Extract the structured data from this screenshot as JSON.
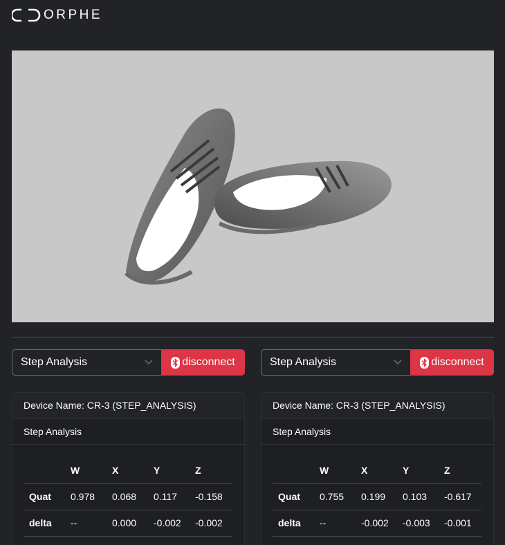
{
  "app": {
    "brand": "ORPHE"
  },
  "viewer": {
    "description": ""
  },
  "panels": [
    {
      "mode_select": "Step Analysis",
      "disconnect_label": "disconnect",
      "device_name": "Device Name: CR-3 (STEP_ANALYSIS)",
      "section_title": "Step Analysis",
      "table": {
        "headers": [
          "",
          "W",
          "X",
          "Y",
          "Z"
        ],
        "rows": [
          [
            "Quat",
            "0.978",
            "0.068",
            "0.117",
            "-0.158"
          ],
          [
            "delta",
            "--",
            "0.000",
            "-0.002",
            "-0.002"
          ]
        ]
      }
    },
    {
      "mode_select": "Step Analysis",
      "disconnect_label": "disconnect",
      "device_name": "Device Name: CR-3 (STEP_ANALYSIS)",
      "section_title": "Step Analysis",
      "table": {
        "headers": [
          "",
          "W",
          "X",
          "Y",
          "Z"
        ],
        "rows": [
          [
            "Quat",
            "0.755",
            "0.199",
            "0.103",
            "-0.617"
          ],
          [
            "delta",
            "--",
            "-0.002",
            "-0.003",
            "-0.001"
          ]
        ]
      }
    }
  ],
  "colors": {
    "accent_danger": "#dc3545",
    "background": "#212327",
    "viewer_bg": "#c8c8c8"
  },
  "icons": {
    "logo": "orphe-logo-icon",
    "bluetooth": "bluetooth-icon",
    "chevron": "chevron-down-icon"
  }
}
